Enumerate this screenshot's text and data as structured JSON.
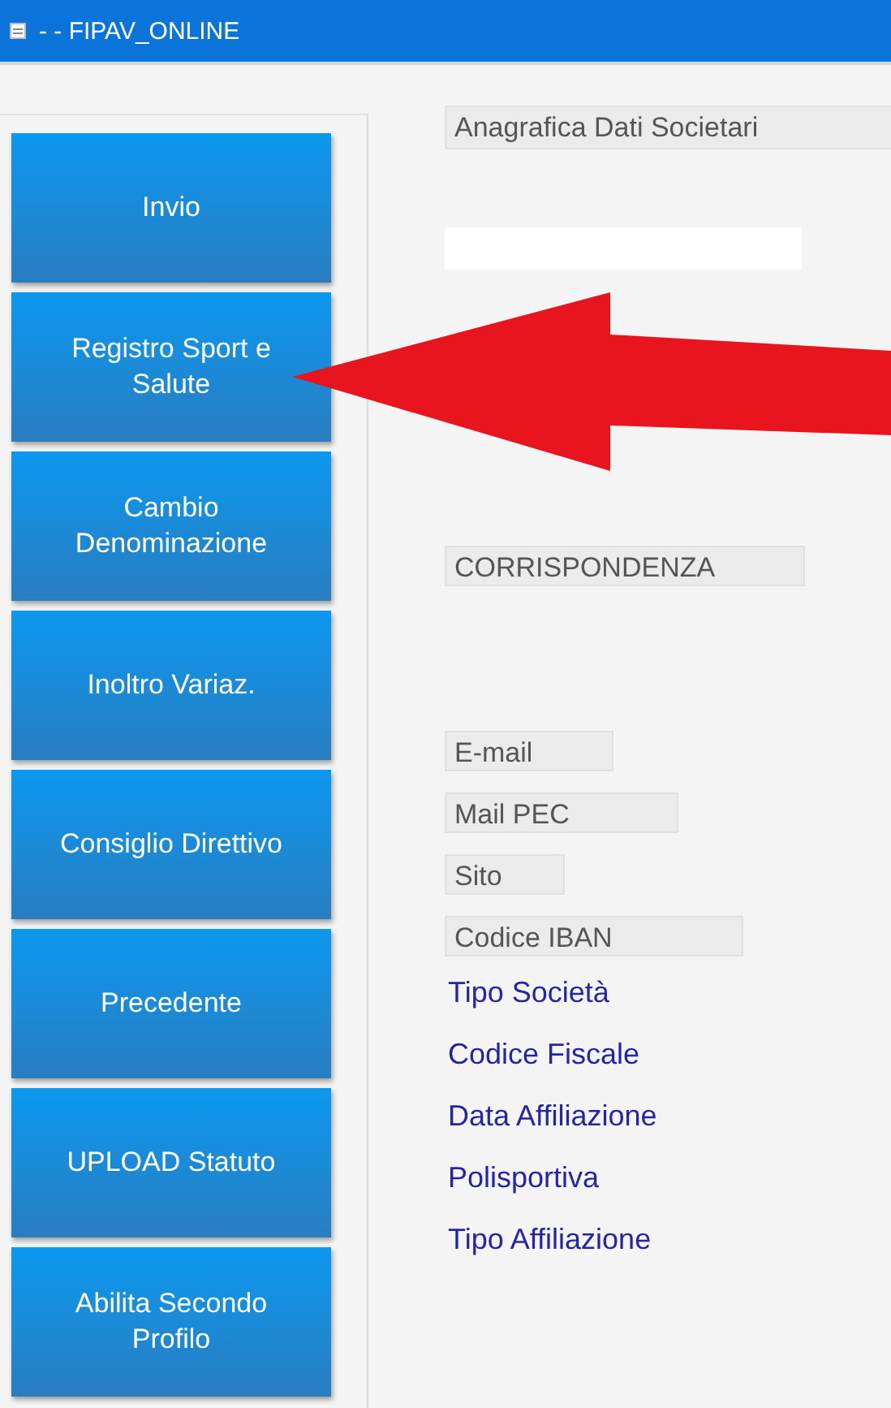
{
  "window": {
    "title": "- - FIPAV_ONLINE"
  },
  "sidebar": {
    "buttons": [
      {
        "label": "Invio"
      },
      {
        "label": "Registro Sport e Salute"
      },
      {
        "label": "Cambio Denominazione"
      },
      {
        "label": "Inoltro Variaz."
      },
      {
        "label": "Consiglio Direttivo"
      },
      {
        "label": "Precedente"
      },
      {
        "label": "UPLOAD Statuto"
      },
      {
        "label": "Abilita Secondo Profilo"
      }
    ]
  },
  "main": {
    "header_label": "Anagrafica Dati Societari",
    "section_label": "CORRISPONDENZA",
    "field_labels": [
      "E-mail",
      "Mail PEC",
      "Sito",
      "Codice IBAN"
    ],
    "links": [
      "Tipo Società",
      "Codice Fiscale",
      "Data Affiliazione",
      "Polisportiva",
      "Tipo Affiliazione"
    ]
  }
}
